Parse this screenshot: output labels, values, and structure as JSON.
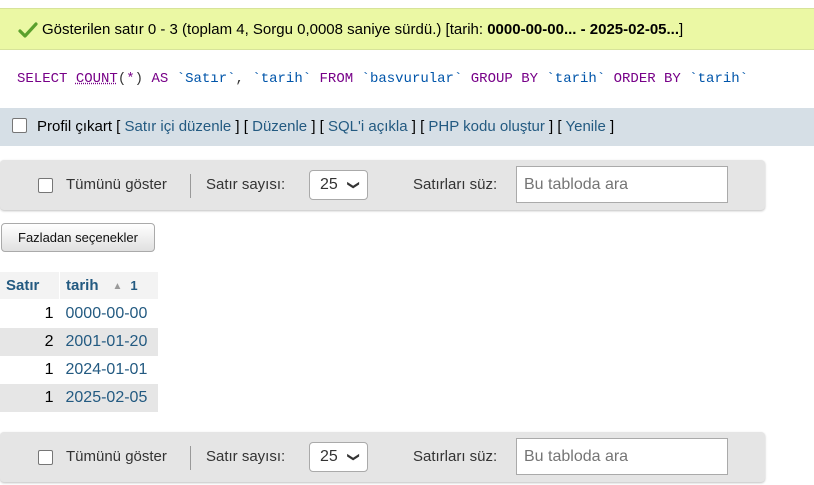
{
  "message": {
    "prefix": "Gösterilen satır 0 - 3 (toplam 4, Sorgu 0,0008 saniye sürdü.) [tarih: ",
    "range": "0000-00-00... - 2025-02-05...",
    "suffix": "]"
  },
  "sql": {
    "select": "SELECT",
    "count": "COUNT",
    "paren_open": "(",
    "star": "*",
    "paren_close": ")",
    "as": "AS",
    "alias": "`Satır`",
    "comma": ",",
    "col": "`tarih`",
    "from": "FROM",
    "table": "`basvurular`",
    "group_by": "GROUP BY",
    "group_col": "`tarih`",
    "order_by": "ORDER BY",
    "order_col": "`tarih`"
  },
  "tools": {
    "profile_label": "Profil çıkart",
    "links": [
      "Satır içi düzenle",
      "Düzenle",
      "SQL'i açıkla",
      "PHP kodu oluştur",
      "Yenile"
    ]
  },
  "nav": {
    "show_all": "Tümünü göster",
    "rows_label": "Satır sayısı:",
    "rows_value": "25",
    "filter_label": "Satırları süz:",
    "search_placeholder": "Bu tabloda ara"
  },
  "more_options": "Fazladan seçenekler",
  "table": {
    "headers": [
      "Satır",
      "tarih"
    ],
    "sort_number": "1",
    "rows": [
      {
        "count": "1",
        "date": "0000-00-00"
      },
      {
        "count": "2",
        "date": "2001-01-20"
      },
      {
        "count": "1",
        "date": "2024-01-01"
      },
      {
        "count": "1",
        "date": "2025-02-05"
      }
    ]
  },
  "colors": {
    "success_bg": "#ebf8a4",
    "link": "#235a81",
    "sql_keyword": "#770088",
    "sql_identifier": "#0055aa"
  }
}
